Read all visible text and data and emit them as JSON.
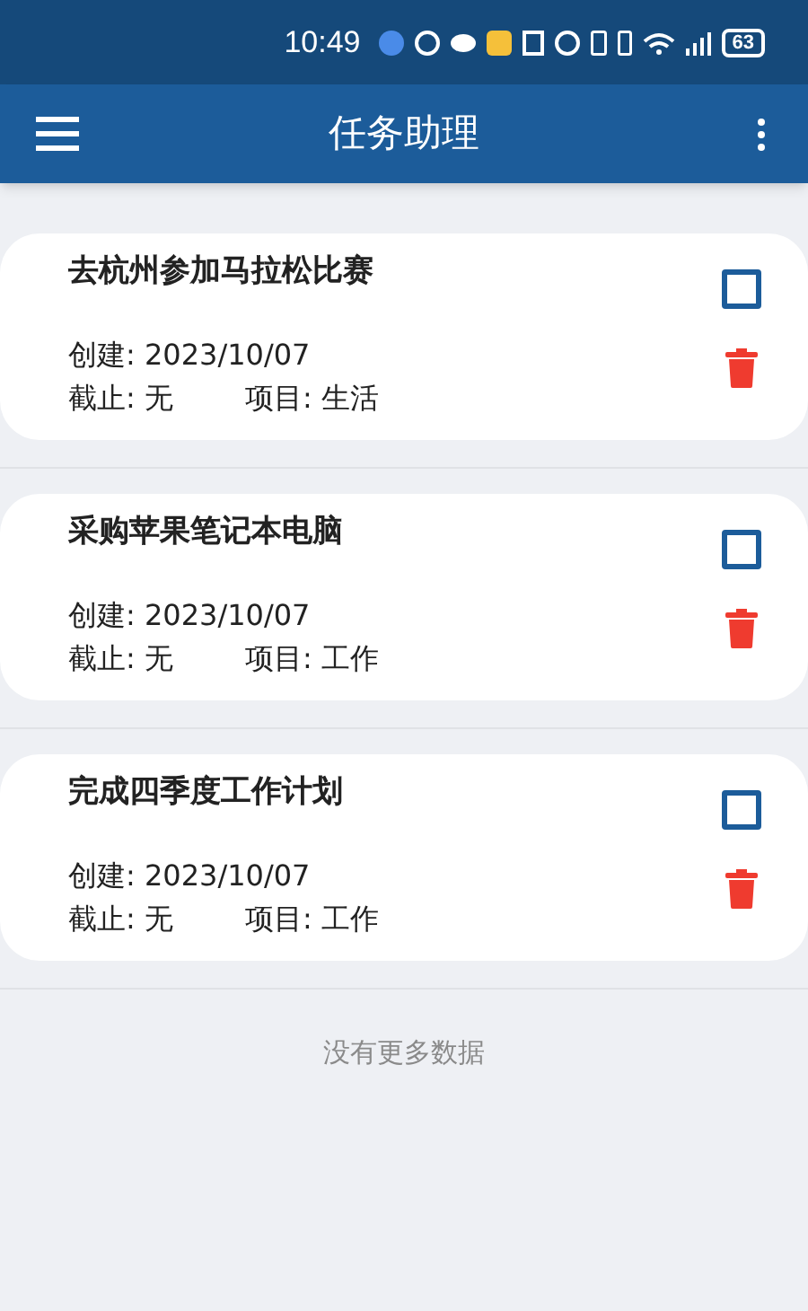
{
  "status_bar": {
    "time": "10:49",
    "battery": "63"
  },
  "app_bar": {
    "title": "任务助理"
  },
  "tasks": [
    {
      "title": "去杭州参加马拉松比赛",
      "created": "创建: 2023/10/07",
      "deadline": "截止: 无",
      "project": "项目: 生活",
      "checked": false
    },
    {
      "title": "采购苹果笔记本电脑",
      "created": "创建: 2023/10/07",
      "deadline": "截止: 无",
      "project": "项目: 工作",
      "checked": false
    },
    {
      "title": "完成四季度工作计划",
      "created": "创建: 2023/10/07",
      "deadline": "截止: 无",
      "project": "项目: 工作",
      "checked": false
    }
  ],
  "footer": "没有更多数据"
}
